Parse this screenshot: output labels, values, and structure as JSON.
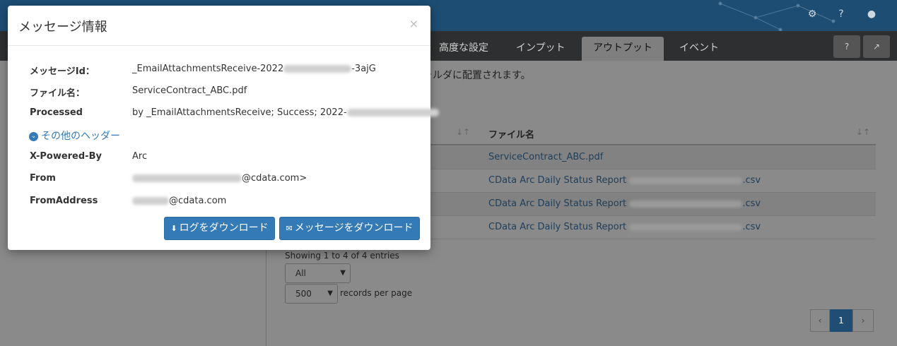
{
  "header": {
    "icons": [
      "gear-icon",
      "help-icon",
      "user-icon"
    ]
  },
  "tabs": [
    {
      "label": "高度な設定",
      "active": false
    },
    {
      "label": "インプット",
      "active": false
    },
    {
      "label": "アウトプット",
      "active": true
    },
    {
      "label": "イベント",
      "active": false
    }
  ],
  "main": {
    "note": "ォルダに配置されます。",
    "table": {
      "column_file": "ファイル名",
      "rows": [
        {
          "file": "ServiceContract_ABC.pdf",
          "suffix": ""
        },
        {
          "file": "CData Arc Daily Status Report",
          "suffix": ".csv"
        },
        {
          "file": "CData Arc Daily Status Report",
          "suffix": ".csv"
        },
        {
          "file": "CData Arc Daily Status Report",
          "suffix": ".csv"
        }
      ]
    },
    "showing": "Showing 1 to 4 of 4 entries",
    "filter_value": "All",
    "page_size_value": "500",
    "records_per_page": "records per page",
    "pager": {
      "prev": "‹",
      "current": "1",
      "next": "›"
    }
  },
  "modal": {
    "title": "メッセージ情報",
    "close": "×",
    "fields": [
      {
        "key": "メッセージId：",
        "value": "_EmailAttachmentsReceive-2022",
        "tail": "-3ajG"
      },
      {
        "key": "ファイル名：",
        "value": "ServiceContract_ABC.pdf",
        "tail": ""
      },
      {
        "key": "Processed",
        "value": "by _EmailAttachmentsReceive; Success; 2022-",
        "tail": ""
      }
    ],
    "more_headers": "その他のヘッダー",
    "headers": [
      {
        "key": "X-Powered-By",
        "value": "",
        "tail": "Arc"
      },
      {
        "key": "From",
        "value": "",
        "tail": "@cdata.com>"
      },
      {
        "key": "FromAddress",
        "value": "",
        "tail": "@cdata.com"
      }
    ],
    "buttons": {
      "download_log": "ログをダウンロード",
      "download_message": "メッセージをダウンロード"
    }
  }
}
